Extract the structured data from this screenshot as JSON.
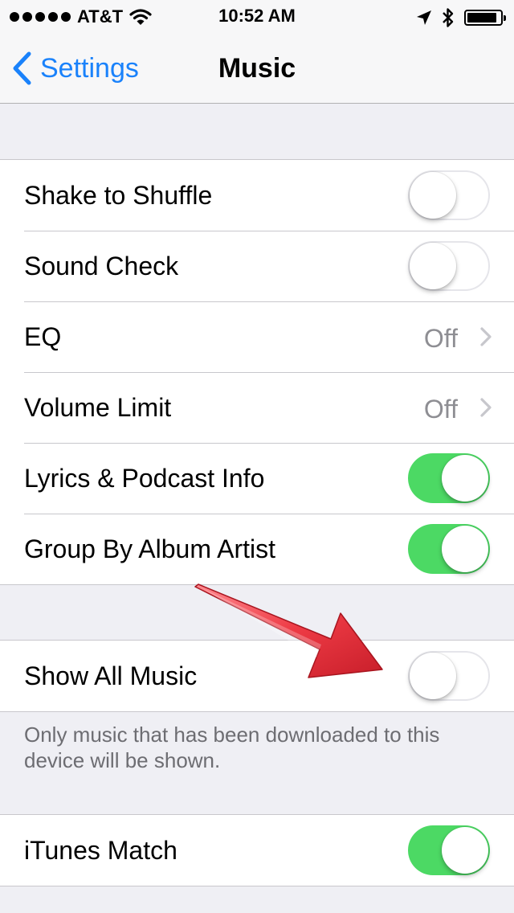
{
  "status": {
    "carrier": "AT&T",
    "time": "10:52 AM",
    "battery_level": 0.9
  },
  "nav": {
    "back_label": "Settings",
    "title": "Music"
  },
  "group1": {
    "rows": [
      {
        "label": "Shake to Shuffle",
        "control": "toggle",
        "on": false
      },
      {
        "label": "Sound Check",
        "control": "toggle",
        "on": false
      },
      {
        "label": "EQ",
        "control": "value",
        "value": "Off"
      },
      {
        "label": "Volume Limit",
        "control": "value",
        "value": "Off"
      },
      {
        "label": "Lyrics & Podcast Info",
        "control": "toggle",
        "on": true
      },
      {
        "label": "Group By Album Artist",
        "control": "toggle",
        "on": true
      }
    ]
  },
  "group2": {
    "label": "Show All Music",
    "on": false,
    "footer": "Only music that has been downloaded to this device will be shown."
  },
  "group3": {
    "label": "iTunes Match",
    "on": true
  },
  "colors": {
    "accent": "#1a82fb",
    "toggle_on": "#4cd964",
    "annotation_arrow": "#e5303a"
  },
  "icons": [
    "wifi-icon",
    "location-arrow-icon",
    "bluetooth-icon",
    "battery-icon",
    "back-chevron-icon",
    "chevron-right-icon",
    "red-arrow-annotation"
  ]
}
